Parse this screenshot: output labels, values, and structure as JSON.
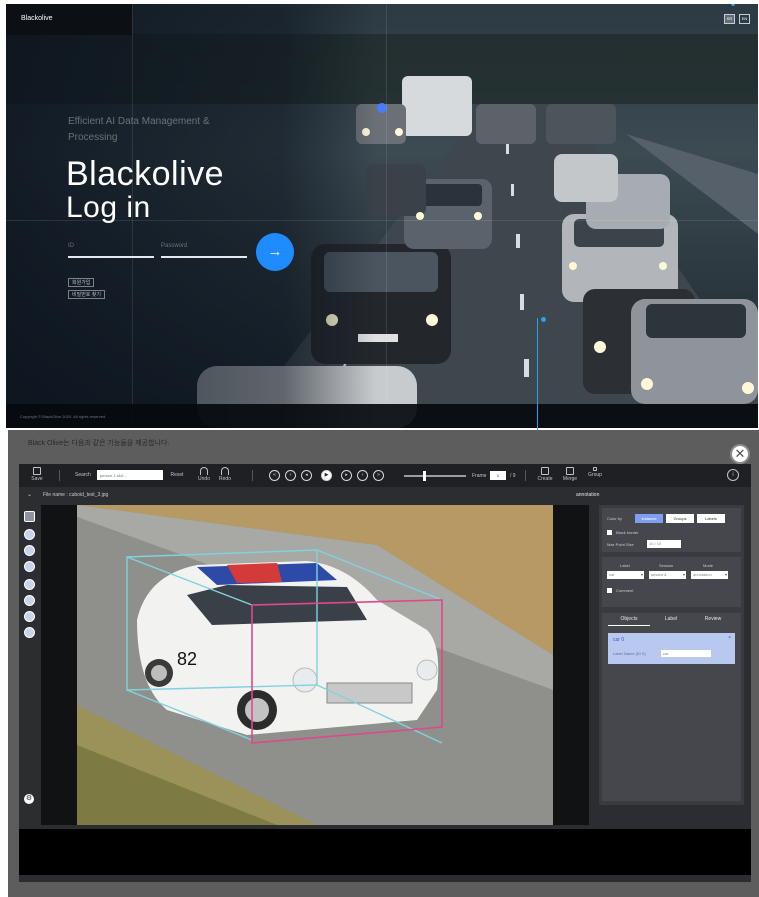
{
  "login": {
    "brand": "Blackolive",
    "languages": [
      "KR",
      "EN"
    ],
    "tagline": "Efficient AI Data Management & Processing",
    "title_line1": "Blackolive",
    "title_line2": "Log in",
    "id_placeholder": "ID",
    "password_placeholder": "Password",
    "submit_label": "→",
    "link_signup": "회원가입",
    "link_find_password": "비밀번호 찾기",
    "copyright": "Copyright © BlackOlive 2020. All rights reserved.",
    "accent_color": "#1e8cff"
  },
  "tool": {
    "caption": "Black Olive는 다음과 같은 기능들을 제공합니다.",
    "close_label": "✕",
    "toolbar": {
      "save_label": "Save",
      "search_label": "Search",
      "search_placeholder": "person-1.skit...",
      "reset_label": "Reset",
      "undo_label": "Undo",
      "redo_label": "Redo",
      "media_buttons": [
        "«",
        "‹",
        "◂",
        "▶",
        "▸",
        "›",
        "»"
      ],
      "frame_label": "Frame",
      "frame_value": "1",
      "frame_total": "/ 9",
      "create_label": "Create",
      "merge_label": "Merge",
      "group_label": "Group",
      "info_label": "i"
    },
    "file_name": "File name : cuboid_test_3.jpg",
    "annotation_header": "annotation",
    "panel": {
      "color_by_label": "Color by",
      "color_by_options": [
        "Instance",
        "Groups",
        "Labels"
      ],
      "black_border_label": "Black border",
      "max_point_size_label": "Max Point Size",
      "max_point_size_value": "10 / 10",
      "label_col": "Label",
      "session_col": "Session",
      "mode_col": "Mode",
      "label_value": "car",
      "session_value": "session1",
      "mode_value": "annotation",
      "comment_label": "Comment",
      "tabs": [
        "Objects",
        "Label",
        "Review"
      ],
      "object_name": "car 0",
      "object_field_label": "Label Name (ID 0)",
      "object_field_value": "car",
      "object_close": "×"
    },
    "left_tools": [
      "cursor-icon",
      "cuboid-icon",
      "polygon-icon",
      "polyline-icon",
      "rotate-icon",
      "undo-icon",
      "copy-icon",
      "hand-icon",
      "settings-icon"
    ],
    "cuboid_colors": {
      "front": "#e0488a",
      "back": "#7fd3e0"
    },
    "image_subject_text": "82"
  }
}
